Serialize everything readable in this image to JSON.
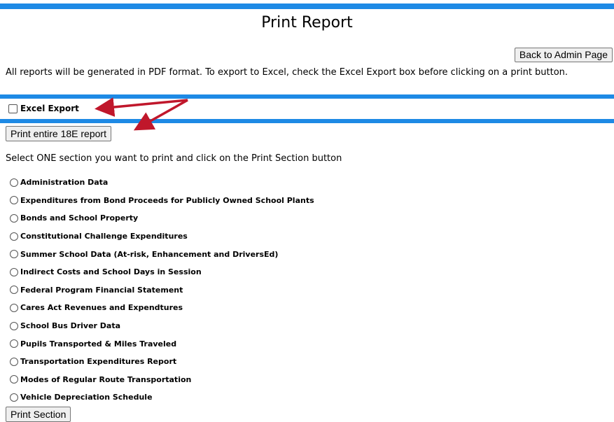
{
  "page": {
    "title": "Print Report",
    "back_button_label": "Back to Admin Page",
    "intro_text": "All reports will be generated in PDF format. To export to Excel, check the Excel Export box before clicking on a print button.",
    "excel_export_label": "Excel Export",
    "print_entire_label": "Print entire 18E report",
    "instruction": "Select ONE section you want to print and click on the Print Section button",
    "print_section_label": "Print Section"
  },
  "sections": [
    {
      "label": "Administration Data"
    },
    {
      "label": "Expenditures from Bond Proceeds for Publicly Owned School Plants"
    },
    {
      "label": "Bonds and School Property"
    },
    {
      "label": "Constitutional Challenge Expenditures"
    },
    {
      "label": "Summer School Data (At-risk, Enhancement and DriversEd)"
    },
    {
      "label": "Indirect Costs and School Days in Session"
    },
    {
      "label": "Federal Program Financial Statement"
    },
    {
      "label": "Cares Act Revenues and Expendtures"
    },
    {
      "label": "School Bus Driver Data"
    },
    {
      "label": "Pupils Transported & Miles Traveled"
    },
    {
      "label": "Transportation Expenditures Report"
    },
    {
      "label": "Modes of Regular Route Transportation"
    },
    {
      "label": "Vehicle Depreciation Schedule"
    }
  ],
  "colors": {
    "accent_bar": "#1e8ae5",
    "annotation_arrow": "#c0172b"
  }
}
